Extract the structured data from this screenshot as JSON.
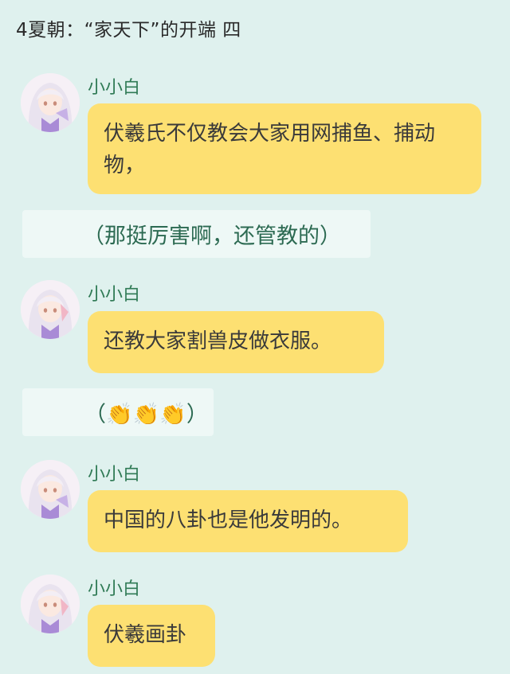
{
  "header": {
    "title": "4夏朝：“家天下”的开端 四"
  },
  "messages": [
    {
      "sender": "小小白",
      "text": "伏羲氏不仅教会大家用网捕鱼、捕动物，"
    },
    {
      "sender": "小小白",
      "text": "还教大家割兽皮做衣服。"
    },
    {
      "sender": "小小白",
      "text": "中国的八卦也是他发明的。"
    },
    {
      "sender": "小小白",
      "text": "伏羲画卦"
    }
  ],
  "notes": [
    {
      "text": "（那挺厉害啊，还管教的）"
    },
    {
      "text": "（👏👏👏）"
    }
  ],
  "colors": {
    "background": "#dff1ee",
    "bubble": "#fde072",
    "note_bg": "#eef8f6",
    "sender_name": "#2f7a55"
  }
}
